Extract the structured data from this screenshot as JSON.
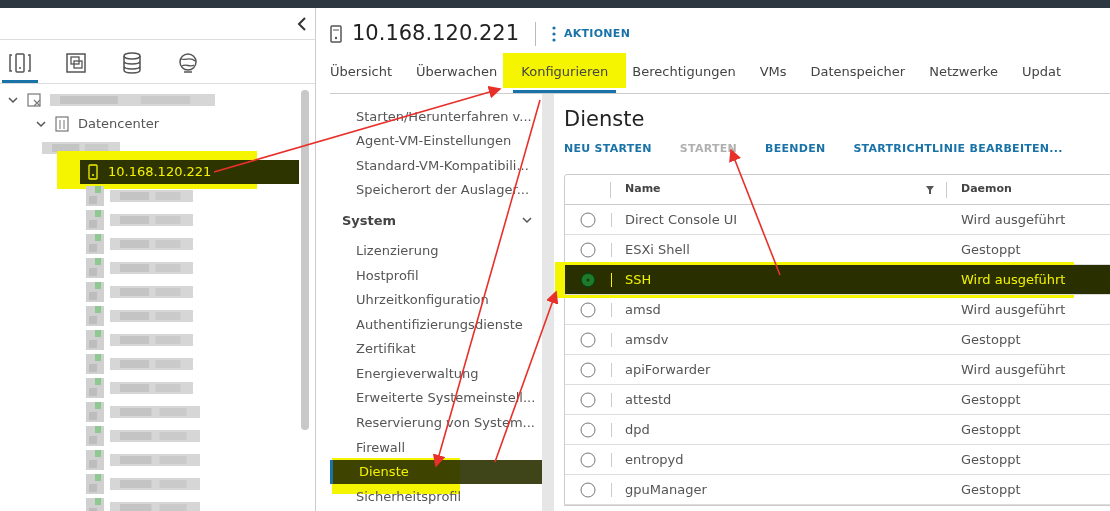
{
  "inventory_tabs": [
    {
      "kind": "hosts",
      "selected": true
    },
    {
      "kind": "vms",
      "selected": false
    },
    {
      "kind": "storage",
      "selected": false
    },
    {
      "kind": "network",
      "selected": false
    }
  ],
  "tree": [
    {
      "kind": "redacted",
      "expanded": true,
      "children": [
        {
          "kind": "datacenter",
          "label": "Datencenter",
          "expanded": true,
          "children": [
            {
              "kind": "redacted",
              "expanded": true,
              "children": [
                {
                  "kind": "host",
                  "label": "10.168.120.221",
                  "selected": true,
                  "highlighted": true
                },
                {
                  "kind": "redacted-vm"
                },
                {
                  "kind": "redacted-vm"
                },
                {
                  "kind": "redacted-vm"
                },
                {
                  "kind": "redacted-vm"
                },
                {
                  "kind": "redacted-vm"
                },
                {
                  "kind": "redacted-vm"
                },
                {
                  "kind": "redacted-vm"
                },
                {
                  "kind": "redacted-vm"
                },
                {
                  "kind": "redacted-vm"
                },
                {
                  "kind": "redacted-vm"
                },
                {
                  "kind": "redacted-vm"
                },
                {
                  "kind": "redacted-vm"
                },
                {
                  "kind": "redacted-vm"
                },
                {
                  "kind": "redacted-vm"
                }
              ]
            }
          ]
        }
      ]
    }
  ],
  "header": {
    "title": "10.168.120.221",
    "actions": "AKTIONEN"
  },
  "tabs": [
    {
      "label": "Übersicht",
      "selected": false,
      "highlighted": false
    },
    {
      "label": "Überwachen",
      "selected": false,
      "highlighted": false
    },
    {
      "label": "Konfigurieren",
      "selected": true,
      "highlighted": true
    },
    {
      "label": "Berechtigungen",
      "selected": false,
      "highlighted": false
    },
    {
      "label": "VMs",
      "selected": false,
      "highlighted": false
    },
    {
      "label": "Datenspeicher",
      "selected": false,
      "highlighted": false
    },
    {
      "label": "Netzwerke",
      "selected": false,
      "highlighted": false
    },
    {
      "label": "Updat",
      "selected": false,
      "highlighted": false
    }
  ],
  "config_nav": {
    "items": [
      {
        "label": "Starten/Herunterfahren v...",
        "selected": false
      },
      {
        "label": "Agent-VM-Einstellungen",
        "selected": false
      },
      {
        "label": "Standard-VM-Kompatibili...",
        "selected": false
      },
      {
        "label": "Speicherort der Auslager...",
        "selected": false
      }
    ],
    "groups": [
      {
        "label": "System",
        "expanded": true,
        "items": [
          {
            "label": "Lizenzierung",
            "selected": false,
            "highlighted": false
          },
          {
            "label": "Hostprofil",
            "selected": false,
            "highlighted": false
          },
          {
            "label": "Uhrzeitkonfiguration",
            "selected": false,
            "highlighted": false
          },
          {
            "label": "Authentifizierungsdienste",
            "selected": false,
            "highlighted": false
          },
          {
            "label": "Zertifikat",
            "selected": false,
            "highlighted": false
          },
          {
            "label": "Energieverwaltung",
            "selected": false,
            "highlighted": false
          },
          {
            "label": "Erweiterte Systemeinstell...",
            "selected": false,
            "highlighted": false
          },
          {
            "label": "Reservierung von System...",
            "selected": false,
            "highlighted": false
          },
          {
            "label": "Firewall",
            "selected": false,
            "highlighted": false
          },
          {
            "label": "Dienste",
            "selected": true,
            "highlighted": true
          },
          {
            "label": "Sicherheitsprofil",
            "selected": false,
            "highlighted": false
          }
        ]
      }
    ]
  },
  "services": {
    "title": "Dienste",
    "buttons": [
      {
        "label": "NEU STARTEN",
        "disabled": false
      },
      {
        "label": "STARTEN",
        "disabled": true
      },
      {
        "label": "BEENDEN",
        "disabled": false
      },
      {
        "label": "STARTRICHTLINIE BEARBEITEN...",
        "disabled": false
      }
    ],
    "table": {
      "columns": [
        "Name",
        "Daemon"
      ],
      "rows": [
        {
          "name": "Direct Console UI",
          "daemon": "Wird ausgeführt",
          "selected": false,
          "highlighted": false
        },
        {
          "name": "ESXi Shell",
          "daemon": "Gestoppt",
          "selected": false,
          "highlighted": false
        },
        {
          "name": "SSH",
          "daemon": "Wird ausgeführt",
          "selected": true,
          "highlighted": true
        },
        {
          "name": "amsd",
          "daemon": "Wird ausgeführt",
          "selected": false,
          "highlighted": false
        },
        {
          "name": "amsdv",
          "daemon": "Gestoppt",
          "selected": false,
          "highlighted": false
        },
        {
          "name": "apiForwarder",
          "daemon": "Wird ausgeführt",
          "selected": false,
          "highlighted": false
        },
        {
          "name": "attestd",
          "daemon": "Gestoppt",
          "selected": false,
          "highlighted": false
        },
        {
          "name": "dpd",
          "daemon": "Gestoppt",
          "selected": false,
          "highlighted": false
        },
        {
          "name": "entropyd",
          "daemon": "Gestoppt",
          "selected": false,
          "highlighted": false
        },
        {
          "name": "gpuManager",
          "daemon": "Gestoppt",
          "selected": false,
          "highlighted": false
        }
      ]
    }
  }
}
